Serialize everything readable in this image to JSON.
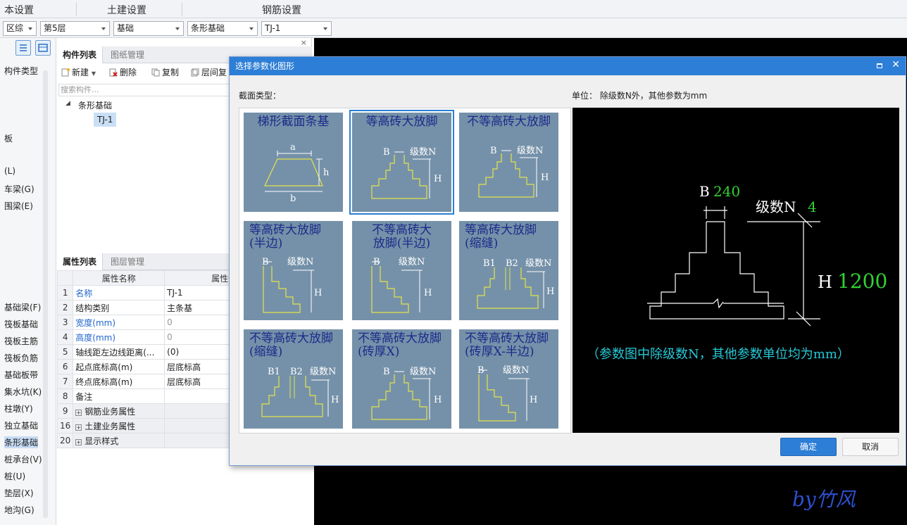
{
  "top_tabs": [
    "本设置",
    "土建设置",
    "钢筋设置"
  ],
  "dropdowns": [
    "区综",
    "第5层",
    "基础",
    "条形基础",
    "TJ-1"
  ],
  "leftnav": {
    "items": [
      "构件类型",
      "板",
      "(L)",
      "车梁(G)",
      "围梁(E)",
      "基础梁(F)",
      "筏板基础",
      "筏板主筋",
      "筏板负筋",
      "基础板带",
      "集水坑(K)",
      "柱墩(Y)",
      "独立基础",
      "条形基础",
      "桩承台(V)",
      "桩(U)",
      "垫层(X)",
      "地沟(G)"
    ]
  },
  "components": {
    "tabs": [
      "构件列表",
      "图纸管理"
    ],
    "toolbar": {
      "new": "新建",
      "delete": "删除",
      "copy": "复制",
      "floor_copy": "层间复"
    },
    "search_placeholder": "搜索构件...",
    "tree": {
      "group": "条形基础",
      "item": "TJ-1"
    }
  },
  "properties": {
    "tabs": [
      "属性列表",
      "图层管理"
    ],
    "col_name": "属性名称",
    "col_value": "属性值",
    "rows": [
      {
        "no": "1",
        "name": "名称",
        "value": "TJ-1"
      },
      {
        "no": "2",
        "name": "结构类别",
        "value": "主条基"
      },
      {
        "no": "3",
        "name": "宽度(mm)",
        "value": "0"
      },
      {
        "no": "4",
        "name": "高度(mm)",
        "value": "0"
      },
      {
        "no": "5",
        "name": "轴线距左边线距离(...",
        "value": "(0)"
      },
      {
        "no": "6",
        "name": "起点底标高(m)",
        "value": "层底标高"
      },
      {
        "no": "7",
        "name": "终点底标高(m)",
        "value": "层底标高"
      },
      {
        "no": "8",
        "name": "备注",
        "value": ""
      },
      {
        "no": "9",
        "name": "钢筋业务属性",
        "value": "",
        "expand": "+"
      },
      {
        "no": "16",
        "name": "土建业务属性",
        "value": "",
        "expand": "+"
      },
      {
        "no": "20",
        "name": "显示样式",
        "value": "",
        "expand": "+"
      }
    ]
  },
  "dialog": {
    "title": "选择参数化图形",
    "section_label": "截面类型：",
    "unit_label": "单位：  除级数N外，其他参数为mm",
    "ok": "确定",
    "cancel": "取消",
    "thumbs": [
      "梯形截面条基",
      "等高砖大放脚",
      "不等高砖大放脚",
      "等高砖大放脚\n(半边)",
      "不等高砖大\n放脚(半边)",
      "等高砖大放脚\n(缩缝)",
      "不等高砖大放脚\n(缩缝)",
      "不等高砖大放脚\n(砖厚X)",
      "不等高砖大放脚\n(砖厚X-半边)"
    ],
    "thumb_labels": {
      "a": "a",
      "b": "b",
      "h": "h",
      "B": "B",
      "N": "级数N",
      "H": "H",
      "B1": "B1",
      "B2": "B2"
    },
    "preview": {
      "B_label": "B",
      "B_value": "240",
      "N_label": "级数N",
      "N_value": "4",
      "H_label": "H",
      "H_value": "1200",
      "note": "（参数图中除级数N，其他参数单位均为mm）"
    }
  },
  "watermark": "by竹风"
}
